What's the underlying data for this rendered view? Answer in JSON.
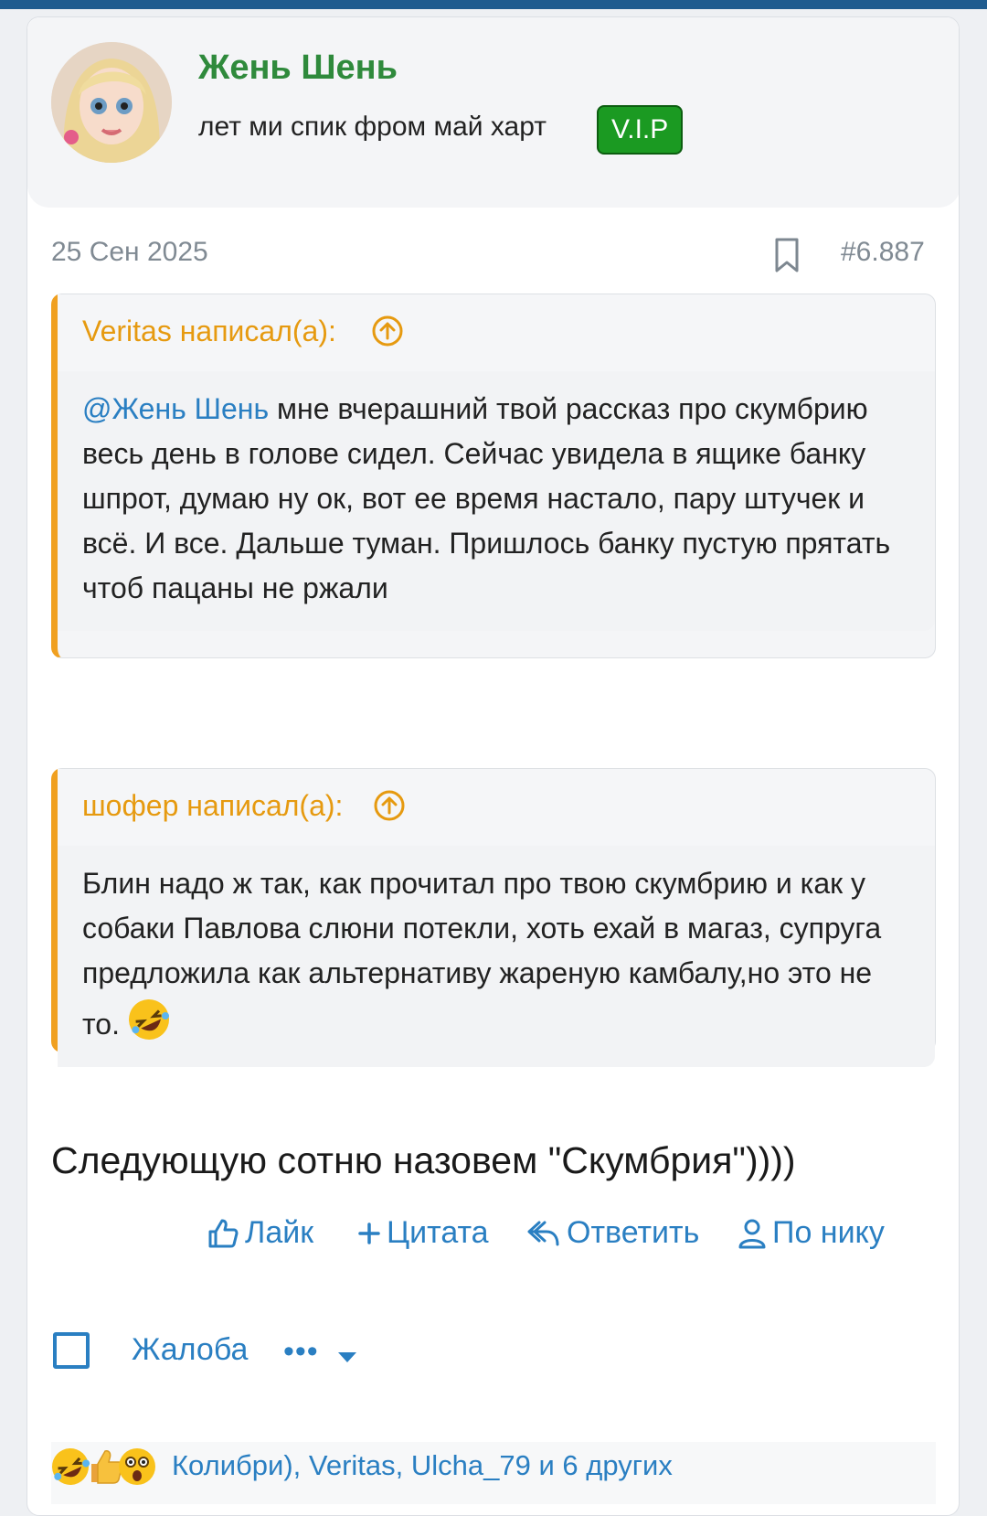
{
  "user": {
    "name": "Жень Шень",
    "title": "лет ми спик фром май харт",
    "badge": "V.I.P"
  },
  "post": {
    "date": "25 Сен 2025",
    "number": "#6.887",
    "quotes": [
      {
        "author": "Veritas написал(а):",
        "mention": "@Жень Шень",
        "text": " мне вчерашний твой рассказ про скумбрию весь день в голове сидел. Сейчас увидела в ящике банку шпрот, думаю ну ок, вот ее время настало, пару штучек и всё. И все. Дальше туман. Пришлось банку пустую прятать чтоб пацаны не ржали"
      },
      {
        "author": "шофер написал(а):",
        "text": "Блин надо ж так, как прочитал про твою скумбрию и как у собаки Павлова слюни потекли, хоть ехай в магаз, супруга предложила как альтернативу жареную камбалу,но это не то.",
        "emoji": "rolling-laughing-emoji"
      }
    ],
    "message": "Следующую сотню назовем \"Скумбрия\"))))"
  },
  "actions": {
    "like": "Лайк",
    "quote": "Цитата",
    "reply": "Ответить",
    "by_nick": "По нику",
    "report": "Жалоба",
    "more": "•••"
  },
  "reactions": {
    "emojis": [
      "rolling-laughing-emoji",
      "thumbs-up-emoji",
      "astonished-emoji"
    ],
    "names": "Колибри), Veritas, Ulcha_79 и 6 других"
  },
  "colors": {
    "accent": "#2a7fc2",
    "username": "#2f8a3c",
    "quote_border": "#f0a020",
    "badge": "#1b9a22",
    "topbar": "#1f5c8f"
  }
}
